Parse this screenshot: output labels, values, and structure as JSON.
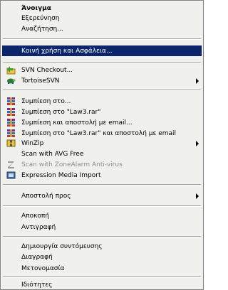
{
  "menu": {
    "items": [
      {
        "label": "Άνοιγμα"
      },
      {
        "label": "Εξερεύνηση"
      },
      {
        "label": "Αναζήτηση..."
      },
      {
        "label": "Κοινή χρήση και Ασφάλεια..."
      },
      {
        "label": "SVN Checkout...",
        "icon": "svn-checkout-icon"
      },
      {
        "label": "TortoiseSVN",
        "icon": "tortoisesvn-icon"
      },
      {
        "label": "Συμπίεση στο...",
        "icon": "winrar-archive-icon"
      },
      {
        "label": "Συμπίεση στο \"Law3.rar\"",
        "icon": "winrar-archive-icon"
      },
      {
        "label": "Συμπίεση και αποστολή με email...",
        "icon": "winrar-archive-icon"
      },
      {
        "label": "Συμπίεση στο \"Law3.rar\" και αποστολή με email",
        "icon": "winrar-archive-icon"
      },
      {
        "label": "WinZip",
        "icon": "winzip-icon"
      },
      {
        "label": "Scan with AVG Free"
      },
      {
        "label": "Scan with ZoneAlarm Anti-virus",
        "icon": "zonealarm-icon"
      },
      {
        "label": "Expression Media Import",
        "icon": "expression-media-icon"
      },
      {
        "label": "Αποστολή προς"
      },
      {
        "label": "Αποκοπή"
      },
      {
        "label": "Αντιγραφή"
      },
      {
        "label": "Δημιουργία συντόμευσης"
      },
      {
        "label": "Διαγραφή"
      },
      {
        "label": "Μετονομασία"
      },
      {
        "label": "Ιδιότητες"
      }
    ]
  },
  "colors": {
    "menu_background": "#f0f0ec",
    "selection": "#0b246a",
    "disabled_text": "#8c8c8c"
  }
}
